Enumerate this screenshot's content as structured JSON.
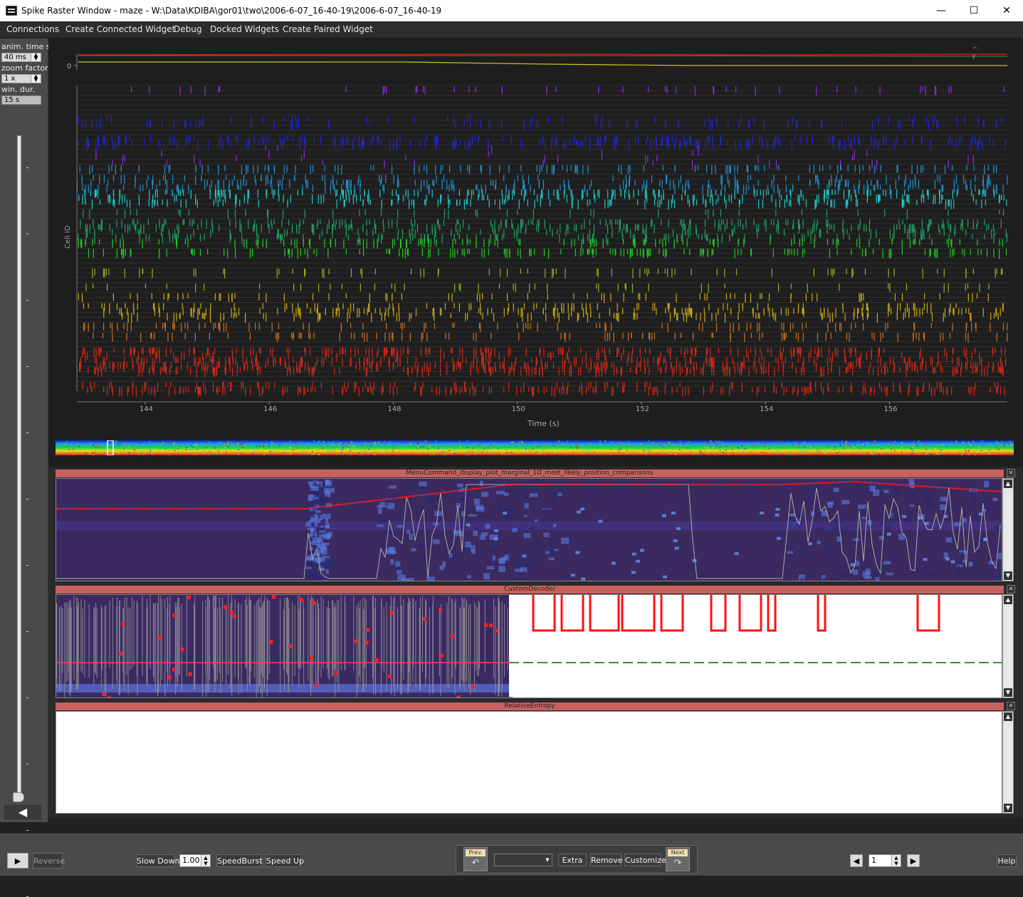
{
  "window": {
    "title": "Spike Raster Window - maze - W:\\Data\\KDIBA\\gor01\\two\\2006-6-07_16-40-19\\2006-6-07_16-40-19",
    "minimize": "—",
    "maximize": "☐",
    "close": "✕"
  },
  "menubar": {
    "items": [
      "Connections",
      "Create Connected Widget",
      "Debug",
      "Docked Widgets",
      "Create Paired Widget"
    ]
  },
  "left_panel": {
    "anim_time_label": "anim. time s",
    "anim_time_value": "40 ms",
    "zoom_factor_label": "zoom factor",
    "zoom_factor_value": "1 x",
    "win_dur_label": "win. dur.",
    "win_dur_value": "15 s",
    "back_arrow": "◀"
  },
  "raster": {
    "top_axis_zero": "0",
    "top_axis_letters": "^\ny",
    "y_label": "Cell ID",
    "x_label": "Time (s)",
    "x_ticks": [
      "144",
      "146",
      "148",
      "150",
      "152",
      "154",
      "156"
    ],
    "x_range": [
      142.9,
      157.9
    ],
    "num_cells": 62,
    "colors": {
      "purple": "#8a2be2",
      "blue": "#2222dd",
      "sky": "#1e90d0",
      "cyan": "#1ec8c8",
      "teal": "#20a060",
      "green": "#22cc22",
      "olive": "#8ab020",
      "gold": "#c8a818",
      "orange": "#c87020",
      "red": "#d02818"
    }
  },
  "docks": [
    {
      "title": "MenuCommand_display_plot_marginal_1D_most_likely_position_comparisons"
    },
    {
      "title": "CustomDecoder"
    },
    {
      "title": "RelativeEntropy"
    }
  ],
  "dock_close": "✕",
  "scroll_up": "▲",
  "scroll_down": "▼",
  "bottom_bar": {
    "play": "▶",
    "reverse": "Reverse",
    "slow_down": "Slow Down",
    "speed_value": "1.00",
    "speed_burst": "SpeedBurst",
    "speed_up": "Speed Up",
    "prev": "Prev.",
    "next": "Next",
    "combo_value": "",
    "extra": "Extra",
    "remove": "Remove",
    "customize": "Customize",
    "page_value": "1",
    "page_prev": "◀",
    "page_next": "▶",
    "help": "Help"
  }
}
